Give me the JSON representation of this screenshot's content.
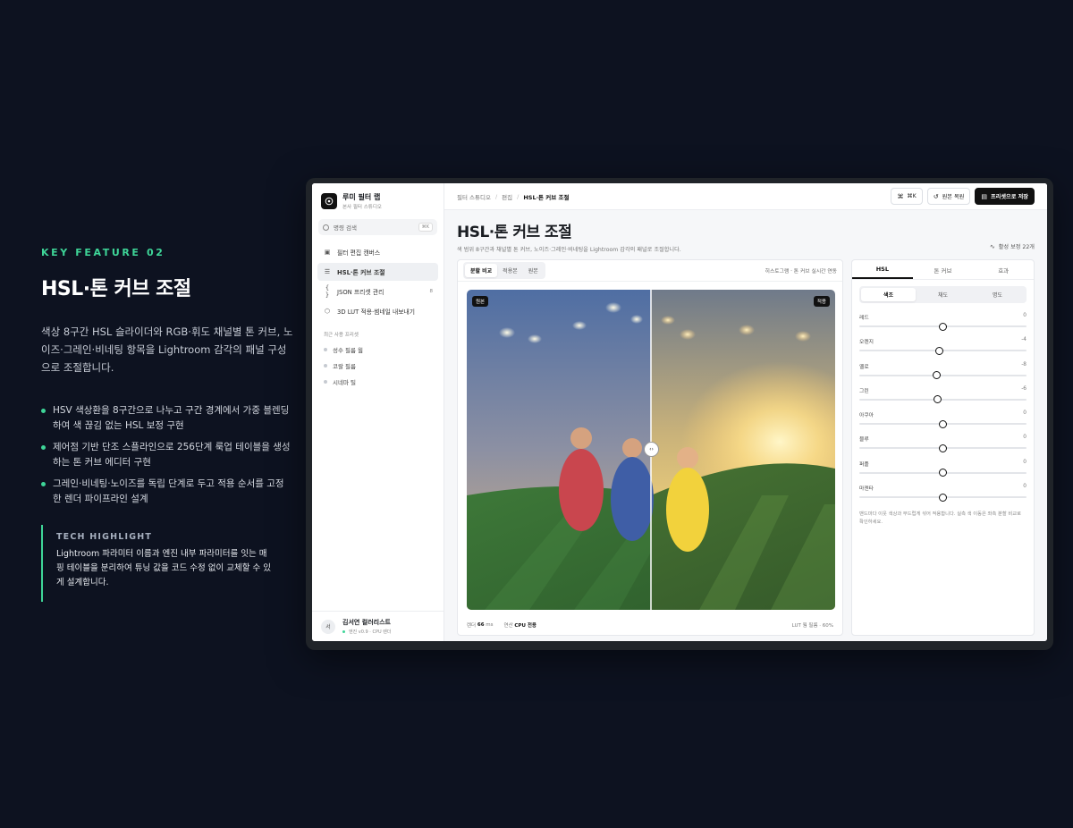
{
  "promo": {
    "eyebrow": "KEY FEATURE 02",
    "title": "HSL·톤 커브 조절",
    "description": "색상 8구간 HSL 슬라이더와 RGB·휘도 채널별 톤 커브, 노이즈·그레인·비네팅 항목을 Lightroom 감각의 패널 구성으로 조절합니다.",
    "bullets": [
      "HSV 색상환을 8구간으로 나누고 구간 경계에서 가중 블렌딩하여 색 끊김 없는 HSL 보정 구현",
      "제어점 기반 단조 스플라인으로 256단계 룩업 테이블을 생성하는 톤 커브 에디터 구현",
      "그레인·비네팅·노이즈를 독립 단계로 두고 적용 순서를 고정한 렌더 파이프라인 설계"
    ],
    "highlight_label": "TECH HIGHLIGHT",
    "highlight_text": "Lightroom 파라미터 이름과 엔진 내부 파라미터를 잇는 매핑 테이블을 분리하여 튜닝 값을 코드 수정 없이 교체할 수 있게 설계합니다."
  },
  "app": {
    "brand_name": "루미 필터 랩",
    "brand_sub": "본사 필터 스튜디오",
    "search_placeholder": "명령 검색",
    "search_shortcut": "⌘K",
    "nav": [
      {
        "label": "필터 편집 캔버스",
        "icon": "image-icon"
      },
      {
        "label": "HSL·톤 커브 조절",
        "icon": "sliders-icon",
        "active": true
      },
      {
        "label": "JSON 프리셋 관리",
        "icon": "braces-icon",
        "badge": "8"
      },
      {
        "label": "3D LUT 적용·썸네일 내보내기",
        "icon": "cube-icon"
      }
    ],
    "recent_label": "최근 사용 프리셋",
    "recent": [
      "성수 필름 웜",
      "코랄 필름",
      "시네마 틸"
    ],
    "user_name": "김서연 컬러리스트",
    "user_sub": "엔진 v0.9 · CPU 렌더",
    "avatar": "서",
    "breadcrumbs": [
      "필터 스튜디오",
      "편집",
      "HSL·톤 커브 조절"
    ],
    "shortcut_btn": "⌘K",
    "reset_btn": "원본 복원",
    "save_btn": "프리셋으로 저장",
    "page_title": "HSL·톤 커브 조절",
    "page_desc": "색 범위 8구간과 채널별 톤 커브, 노이즈·그레인·비네팅을 Lightroom 감각의 패널로 조절합니다.",
    "active_count": "활성 보정 22개",
    "preview_tabs": [
      "분할 비교",
      "적용본",
      "원본"
    ],
    "preview_note": "히스토그램 · 톤 커브 실시간 연동",
    "tag_left": "원본",
    "tag_right": "적용",
    "foot_render_label": "렌더",
    "foot_render_value": "66",
    "foot_render_unit": "ms",
    "foot_compute_label": "연산",
    "foot_compute_value": "CPU 전용",
    "foot_right": "LUT 웜 필름 · 60%",
    "panel_tabs": [
      "HSL",
      "톤 커브",
      "효과"
    ],
    "sub_tabs": [
      "색조",
      "채도",
      "명도"
    ],
    "sliders": [
      {
        "label": "레드",
        "value": 0
      },
      {
        "label": "오렌지",
        "value": -4
      },
      {
        "label": "옐로",
        "value": -8
      },
      {
        "label": "그린",
        "value": -6
      },
      {
        "label": "아쿠아",
        "value": 0
      },
      {
        "label": "블루",
        "value": 0
      },
      {
        "label": "퍼플",
        "value": 0
      },
      {
        "label": "마젠타",
        "value": 0
      }
    ],
    "slider_range": [
      -100,
      100
    ],
    "panel_note": "밴드마다 이웃 색상과 부드럽게 섞어 적용합니다. 실측 색 이동은 좌측 분할 비교로 확인하세요."
  },
  "colors": {
    "accent": "#3ed598",
    "background": "#0d1220",
    "primary_button": "#111111"
  }
}
